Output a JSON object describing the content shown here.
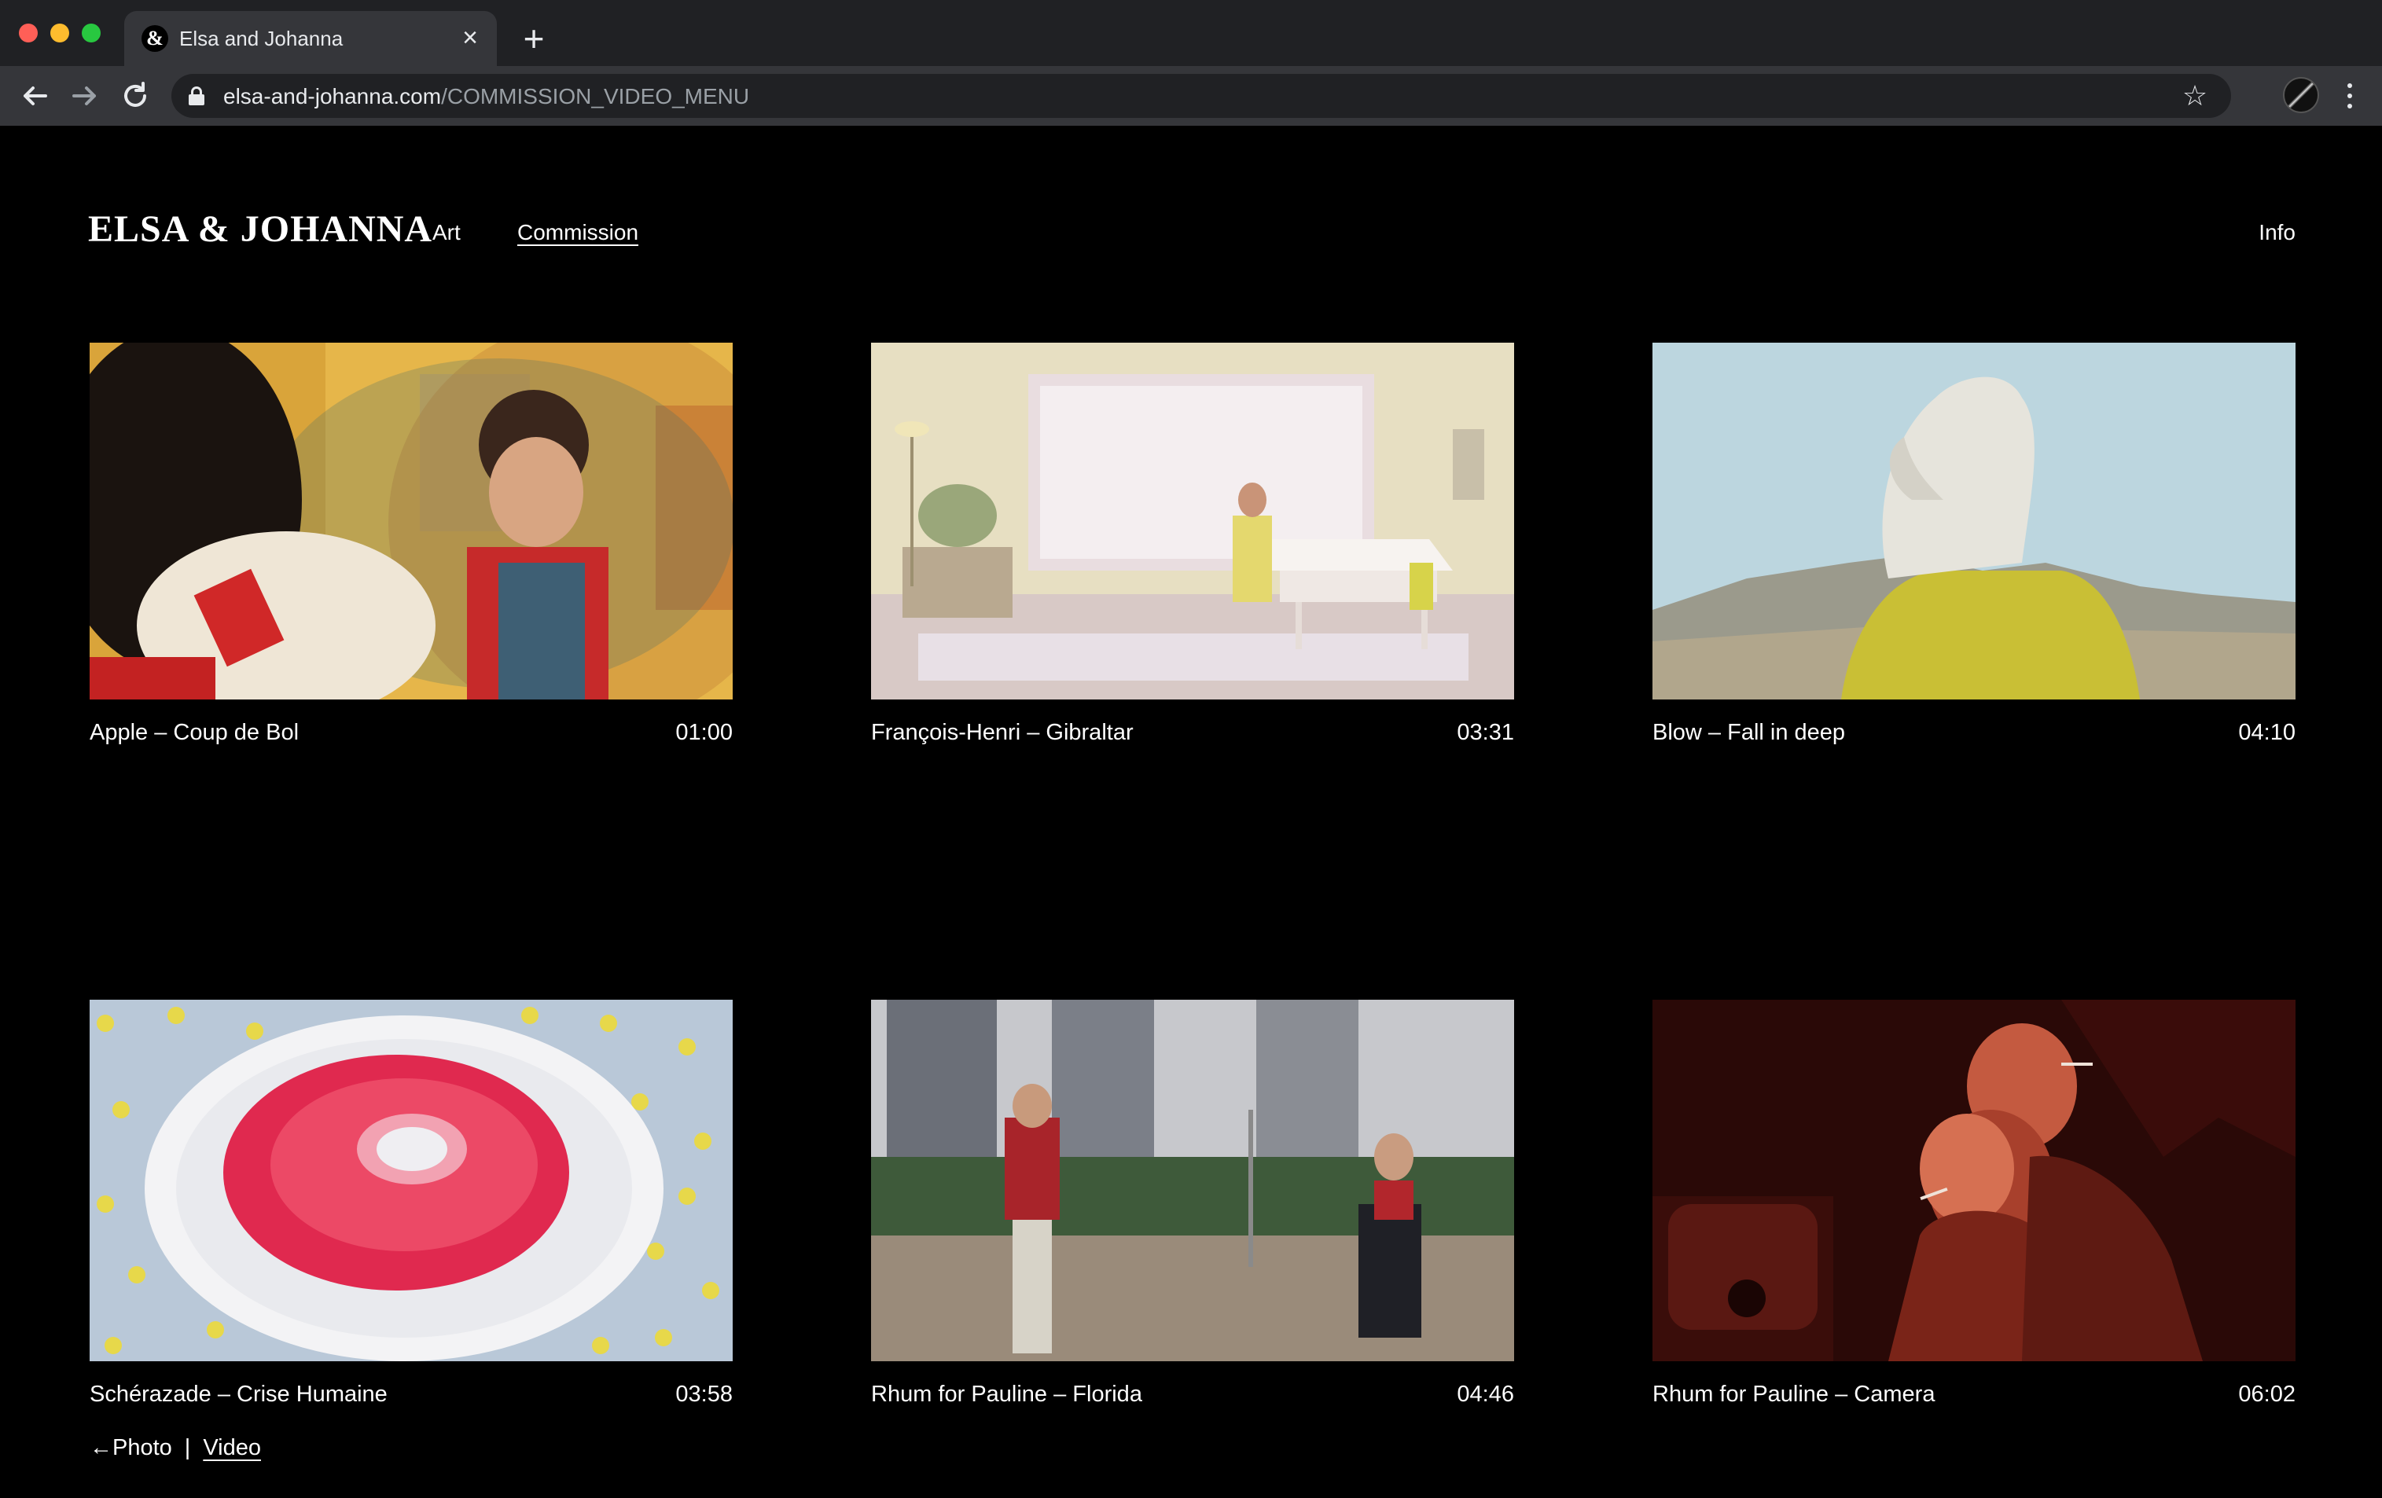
{
  "browser": {
    "tab_title": "Elsa and Johanna",
    "tab_favicon": "&",
    "close_glyph": "×",
    "new_tab_glyph": "+",
    "url_domain": "elsa-and-johanna.com",
    "url_path": "/COMMISSION_VIDEO_MENU",
    "icons": [
      "back-arrow-icon",
      "forward-arrow-icon",
      "reload-icon",
      "lock-icon",
      "bookmark-star-icon",
      "profile-icon",
      "menu-icon"
    ]
  },
  "site": {
    "logo": "ELSA & JOHANNA",
    "nav": {
      "art": "Art",
      "commission": "Commission",
      "info": "Info"
    }
  },
  "videos": [
    {
      "title": "Apple – Coup de Bol",
      "duration": "01:00"
    },
    {
      "title": "François-Henri – Gibraltar",
      "duration": "03:31"
    },
    {
      "title": "Blow – Fall in deep",
      "duration": "04:10"
    },
    {
      "title": "Schérazade – Crise Humaine",
      "duration": "03:58"
    },
    {
      "title": "Rhum for Pauline – Florida",
      "duration": "04:46"
    },
    {
      "title": "Rhum for Pauline – Camera",
      "duration": "06:02"
    }
  ],
  "footer": {
    "photo": "←Photo",
    "separator": "|",
    "video": "Video"
  },
  "colors": {
    "background": "#000000",
    "text": "#ffffff",
    "chrome_dark": "#202124",
    "chrome_light": "#35363a"
  }
}
